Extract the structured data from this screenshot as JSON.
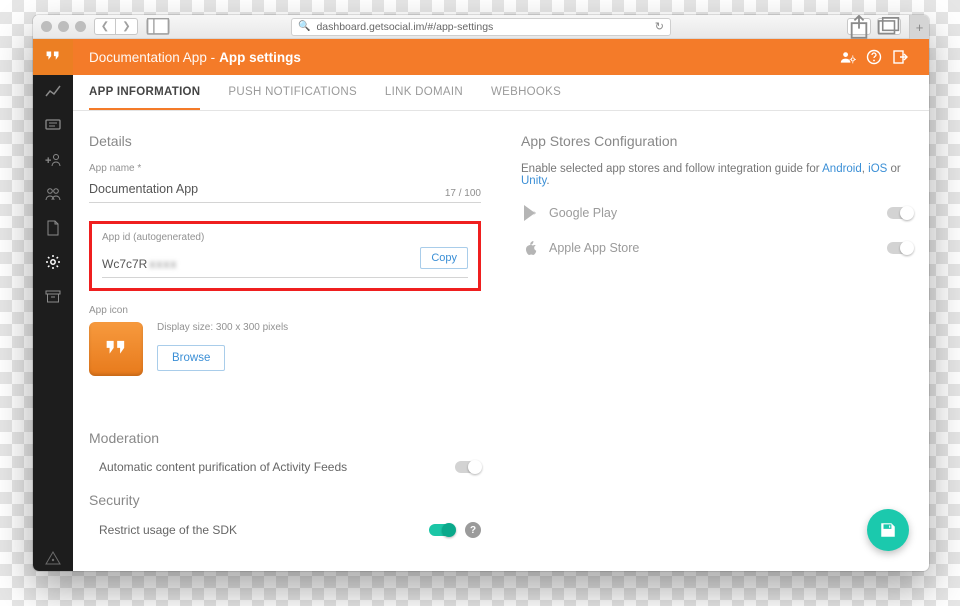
{
  "browser": {
    "url": "dashboard.getsocial.im/#/app-settings"
  },
  "header": {
    "breadcrumb_app": "Documentation App -",
    "breadcrumb_page": "App settings"
  },
  "tabs": [
    {
      "label": "APP INFORMATION",
      "active": true
    },
    {
      "label": "PUSH NOTIFICATIONS",
      "active": false
    },
    {
      "label": "LINK DOMAIN",
      "active": false
    },
    {
      "label": "WEBHOOKS",
      "active": false
    }
  ],
  "details": {
    "section": "Details",
    "app_name_label": "App name *",
    "app_name_value": "Documentation App",
    "app_name_counter": "17 / 100",
    "app_id_label": "App id (autogenerated)",
    "app_id_visible": "Wc7c7R",
    "copy_label": "Copy",
    "app_icon_label": "App icon",
    "display_size_hint": "Display size: 300 x 300 pixels",
    "browse_label": "Browse"
  },
  "moderation": {
    "section": "Moderation",
    "row_label": "Automatic content purification of Activity Feeds",
    "enabled": false
  },
  "security": {
    "section": "Security",
    "row_label": "Restrict usage of the SDK",
    "enabled": true
  },
  "stores": {
    "section": "App Stores Configuration",
    "desc_prefix": "Enable selected app stores and follow integration guide for ",
    "platforms": {
      "android": "Android",
      "ios": "iOS",
      "unity": "Unity"
    },
    "rows": [
      {
        "name": "Google Play",
        "enabled": false
      },
      {
        "name": "Apple App Store",
        "enabled": false
      }
    ]
  }
}
